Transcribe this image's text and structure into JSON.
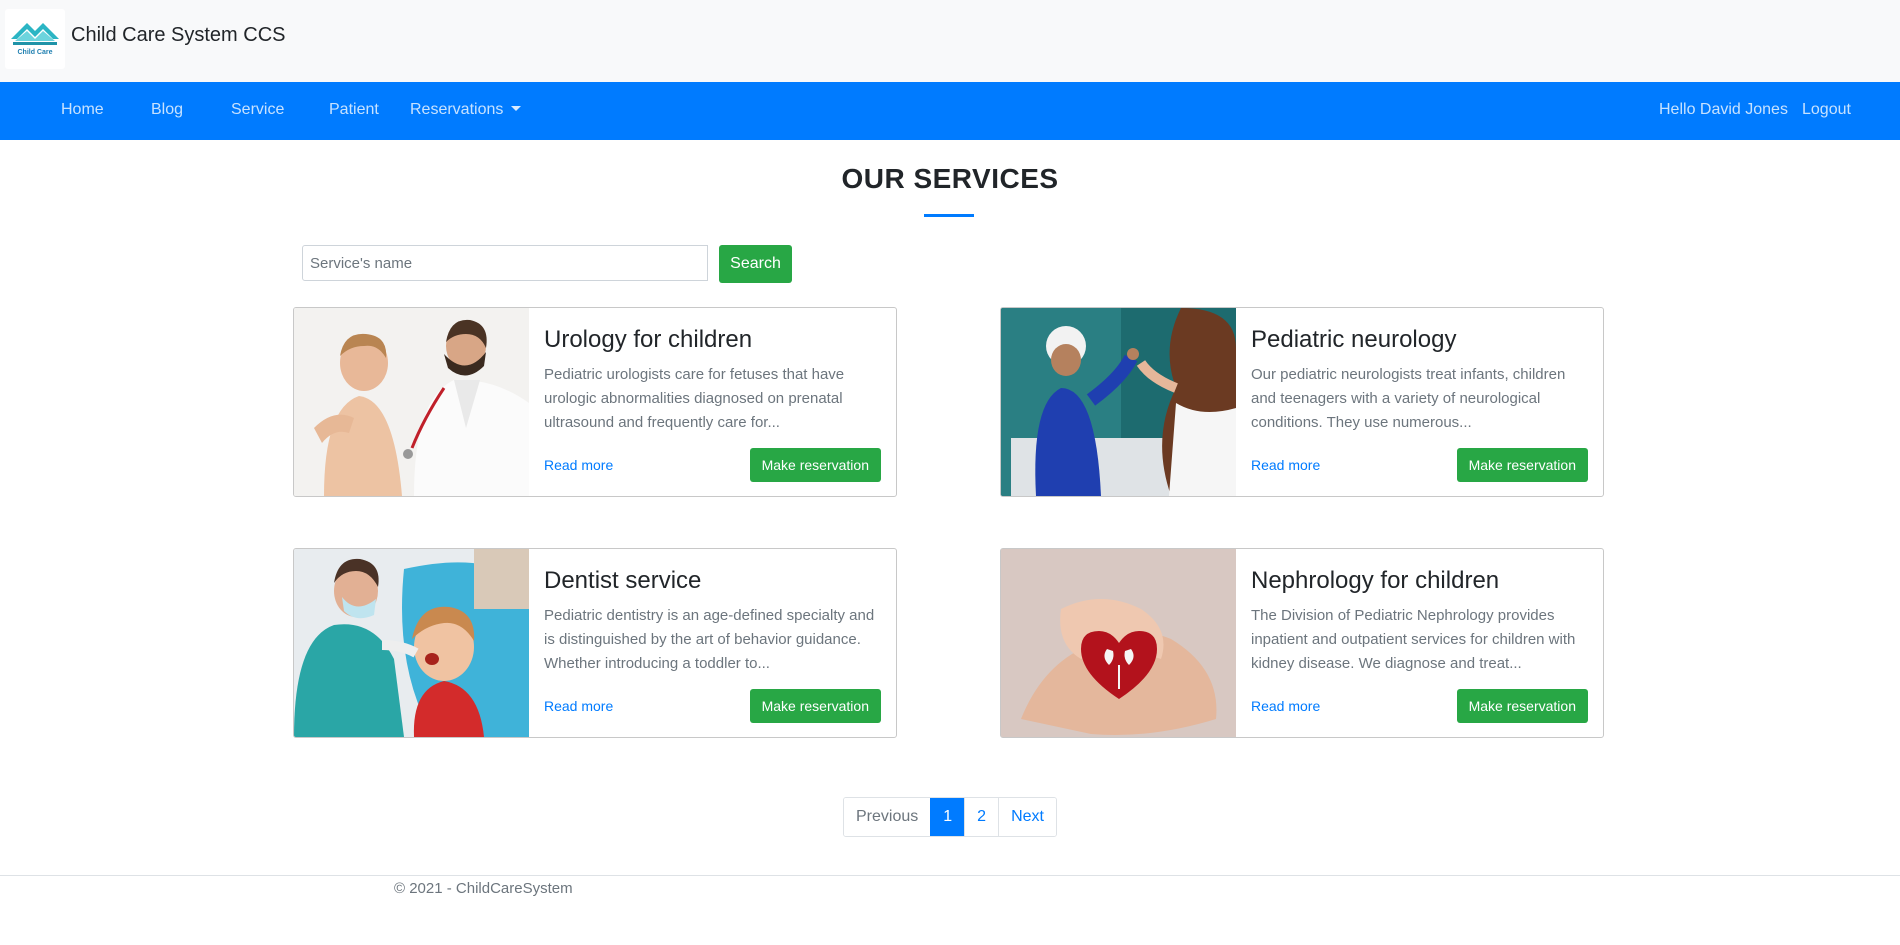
{
  "brand": {
    "logo_text": "Child Care",
    "title": "Child Care System CCS"
  },
  "nav": {
    "items": [
      {
        "label": "Home"
      },
      {
        "label": "Blog"
      },
      {
        "label": "Service"
      },
      {
        "label": "Patient"
      },
      {
        "label": "Reservations"
      }
    ],
    "greeting": "Hello David Jones",
    "logout": "Logout"
  },
  "main": {
    "title": "OUR SERVICES"
  },
  "search": {
    "placeholder": "Service's name",
    "button_label": "Search"
  },
  "services": [
    {
      "title": "Urology for children",
      "description": "Pediatric urologists care for fetuses that have urologic abnormalities diagnosed on prenatal ultrasound and frequently care for...",
      "read_more": "Read more",
      "reserve": "Make reservation"
    },
    {
      "title": "Pediatric neurology",
      "description": "Our pediatric neurologists treat infants, children and teenagers with a variety of neurological conditions. They use numerous...",
      "read_more": "Read more",
      "reserve": "Make reservation"
    },
    {
      "title": "Dentist service",
      "description": "Pediatric dentistry is an age-defined specialty and is distinguished by the art of behavior guidance. Whether introducing a toddler to...",
      "read_more": "Read more",
      "reserve": "Make reservation"
    },
    {
      "title": "Nephrology for children",
      "description": "The Division of Pediatric Nephrology provides inpatient and outpatient services for children with kidney disease. We diagnose and treat...",
      "read_more": "Read more",
      "reserve": "Make reservation"
    }
  ],
  "pagination": {
    "previous": "Previous",
    "pages": [
      "1",
      "2"
    ],
    "current": "1",
    "next": "Next"
  },
  "footer": {
    "text": "© 2021 - ChildCareSystem"
  },
  "colors": {
    "primary": "#007bff",
    "success": "#28a745",
    "brandbar_bg": "#f8f9fa"
  }
}
